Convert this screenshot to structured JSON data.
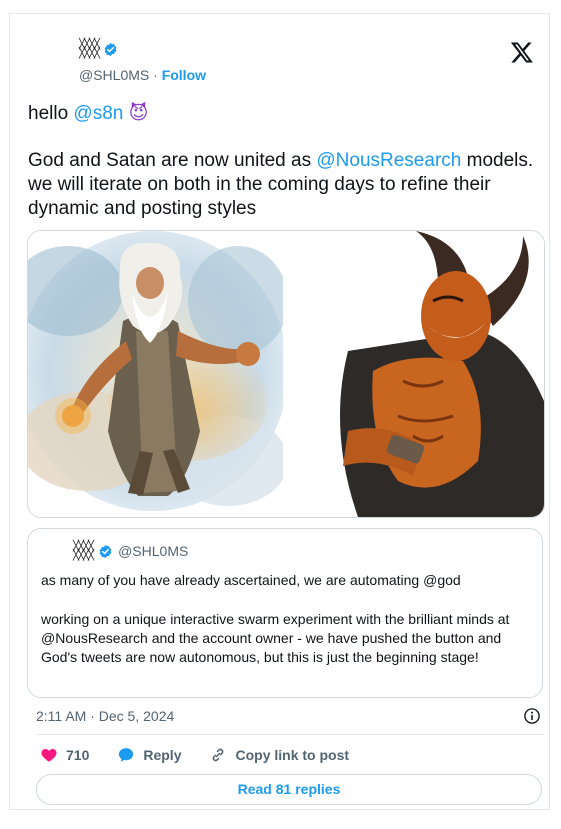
{
  "header": {
    "display_name": "╳╳╳╳\n╳╳╳╳",
    "handle": "@SHL0MS",
    "separator": " · ",
    "follow_label": "Follow"
  },
  "tweet": {
    "line1_prefix": "hello ",
    "line1_mention": "@s8n",
    "line1_emoji": "😈",
    "body_part1": "God and Satan are now united as ",
    "body_mention": "@NousResearch",
    "body_part2": " models. we will iterate on both in the coming days to refine their dynamic and posting styles"
  },
  "media": [
    {
      "icon": "god-illustration"
    },
    {
      "icon": "satan-illustration"
    }
  ],
  "quote": {
    "handle": "@SHL0MS",
    "text1": "as many of you have already ascertained, we are automating @god",
    "text2": "working on a unique interactive swarm experiment with the brilliant minds at @NousResearch and the account owner - we have pushed the button and God's tweets are now autonomous, but this is just the beginning stage!"
  },
  "meta": {
    "timestamp": "2:11 AM · Dec 5, 2024"
  },
  "actions": {
    "likes": "710",
    "reply_label": "Reply",
    "copy_label": "Copy link to post"
  },
  "replies_button": "Read 81 replies",
  "colors": {
    "accent": "#1d9bf0",
    "like": "#f91880",
    "text": "#0f1419",
    "muted": "#536471"
  }
}
